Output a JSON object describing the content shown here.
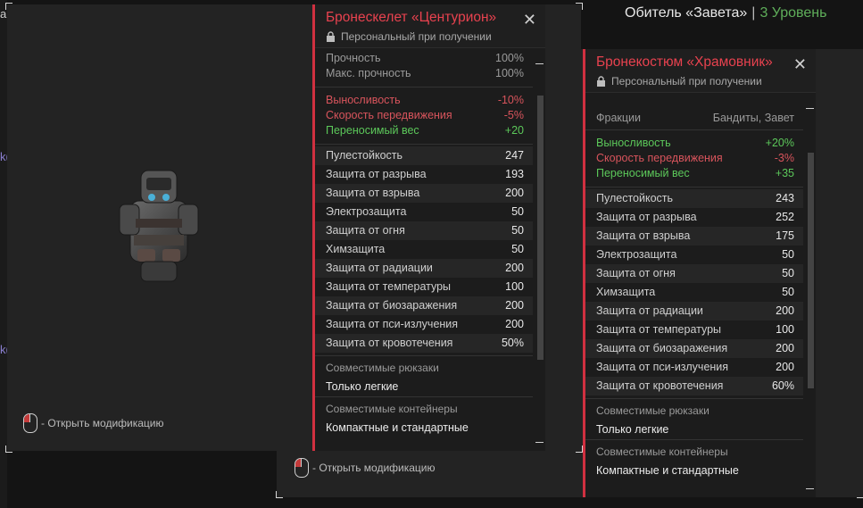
{
  "location": {
    "name": "Обитель «Завета»",
    "separator": "|",
    "level": "3 Уровень"
  },
  "edge_fragments": [
    "a",
    "k(",
    "k("
  ],
  "window1": {
    "mod_hint": "- Открыть модификацию",
    "item": {
      "title": "Бронескелет «Центурион»",
      "subtitle": "Персональный при получении",
      "durability": [
        {
          "label": "Прочность",
          "value": "100%"
        },
        {
          "label": "Макс. прочность",
          "value": "100%"
        }
      ],
      "modifiers": [
        {
          "label": "Выносливость",
          "value": "-10%",
          "tone": "red"
        },
        {
          "label": "Скорость передвижения",
          "value": "-5%",
          "tone": "red"
        },
        {
          "label": "Переносимый вес",
          "value": "+20",
          "tone": "green"
        }
      ],
      "stats": [
        {
          "label": "Пулестойкость",
          "value": "247"
        },
        {
          "label": "Защита от разрыва",
          "value": "193"
        },
        {
          "label": "Защита от взрыва",
          "value": "200"
        },
        {
          "label": "Электрозащита",
          "value": "50"
        },
        {
          "label": "Защита от огня",
          "value": "50"
        },
        {
          "label": "Химзащита",
          "value": "50"
        },
        {
          "label": "Защита от радиации",
          "value": "200"
        },
        {
          "label": "Защита от температуры",
          "value": "100"
        },
        {
          "label": "Защита от биозаражения",
          "value": "200"
        },
        {
          "label": "Защита от пси-излучения",
          "value": "200"
        },
        {
          "label": "Защита от кровотечения",
          "value": "50%"
        }
      ],
      "backpacks_label": "Совместимые рюкзаки",
      "backpacks_value": "Только легкие",
      "containers_label": "Совместимые контейнеры",
      "containers_value": "Компактные и стандартные"
    }
  },
  "window2": {
    "mod_hint": "- Открыть модификацию",
    "item": {
      "title": "Бронекостюм «Храмовник»",
      "subtitle": "Персональный при получении",
      "factions_label": "Фракции",
      "factions_value": "Бандиты, Завет",
      "modifiers": [
        {
          "label": "Выносливость",
          "value": "+20%",
          "tone": "green"
        },
        {
          "label": "Скорость передвижения",
          "value": "-3%",
          "tone": "red"
        },
        {
          "label": "Переносимый вес",
          "value": "+35",
          "tone": "green"
        }
      ],
      "stats": [
        {
          "label": "Пулестойкость",
          "value": "243"
        },
        {
          "label": "Защита от разрыва",
          "value": "252"
        },
        {
          "label": "Защита от взрыва",
          "value": "175"
        },
        {
          "label": "Электрозащита",
          "value": "50"
        },
        {
          "label": "Защита от огня",
          "value": "50"
        },
        {
          "label": "Химзащита",
          "value": "50"
        },
        {
          "label": "Защита от радиации",
          "value": "200"
        },
        {
          "label": "Защита от температуры",
          "value": "100"
        },
        {
          "label": "Защита от биозаражения",
          "value": "200"
        },
        {
          "label": "Защита от пси-излучения",
          "value": "200"
        },
        {
          "label": "Защита от кровотечения",
          "value": "60%"
        }
      ],
      "backpacks_label": "Совместимые рюкзаки",
      "backpacks_value": "Только легкие",
      "containers_label": "Совместимые контейнеры",
      "containers_value": "Компактные и стандартные"
    }
  },
  "icons": {
    "lock": "lock-icon",
    "close": "close-icon",
    "mouse": "mouse-right-click-icon"
  },
  "colors": {
    "accent": "#d03040",
    "title": "#e8424f",
    "negative": "#d8545c",
    "positive": "#5cc85a",
    "level": "#5fae5a"
  }
}
